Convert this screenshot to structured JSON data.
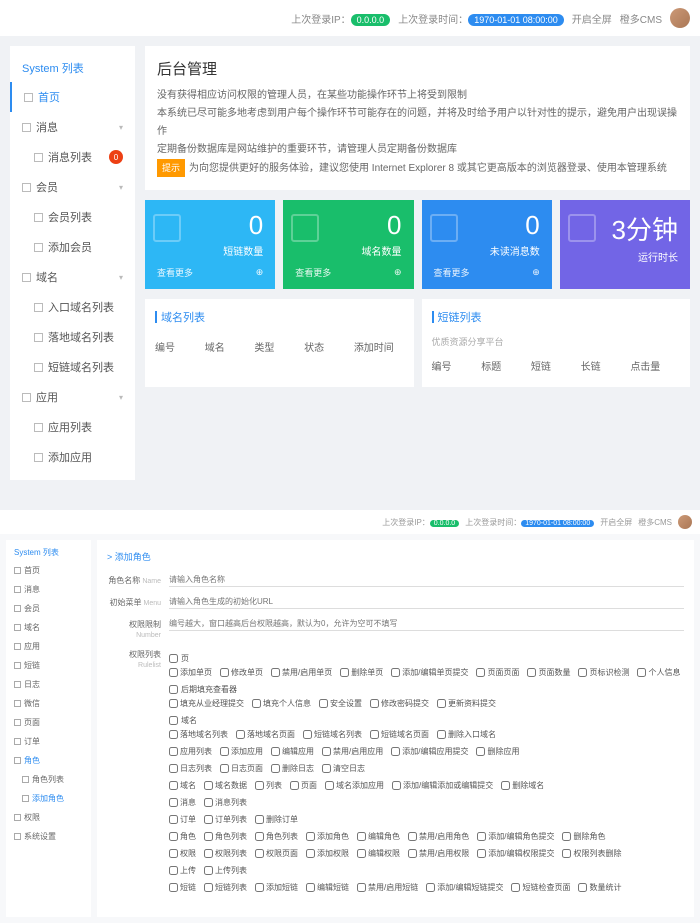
{
  "screen1": {
    "topbar": {
      "lastIpLabel": "上次登录IP：",
      "lastIp": "0.0.0.0",
      "lastTimeLabel": "上次登录时间：",
      "lastTime": "1970-01-01 08:00:00",
      "fullscreen": "开启全屏",
      "cms": "橙多CMS"
    },
    "sidebar": {
      "header": "System 列表",
      "items": [
        {
          "label": "首页",
          "active": true
        },
        {
          "label": "消息",
          "chev": true
        },
        {
          "label": "消息列表",
          "sub": true,
          "badge": "0"
        },
        {
          "label": "会员",
          "chev": true
        },
        {
          "label": "会员列表",
          "sub": true
        },
        {
          "label": "添加会员",
          "sub": true
        },
        {
          "label": "域名",
          "chev": true
        },
        {
          "label": "入口域名列表",
          "sub": true
        },
        {
          "label": "落地域名列表",
          "sub": true
        },
        {
          "label": "短链域名列表",
          "sub": true
        },
        {
          "label": "应用",
          "chev": true
        },
        {
          "label": "应用列表",
          "sub": true
        },
        {
          "label": "添加应用",
          "sub": true
        }
      ]
    },
    "panel": {
      "title": "后台管理",
      "lines": [
        "没有获得相应访问权限的管理人员，在某些功能操作环节上将受到限制",
        "本系统已尽可能多地考虑到用户每个操作环节可能存在的问题，并将及时给予用户以针对性的提示，避免用户出现误操作",
        "定期备份数据库是网站维护的重要环节，请管理人员定期备份数据库"
      ],
      "tipLabel": "提示",
      "tipText": "为向您提供更好的服务体验，建议您使用 Internet Explorer 8 或其它更高版本的浏览器登录、使用本管理系统"
    },
    "cards": [
      {
        "num": "0",
        "label": "短链数量",
        "more": "查看更多",
        "cls": "c1"
      },
      {
        "num": "0",
        "label": "域名数量",
        "more": "查看更多",
        "cls": "c2"
      },
      {
        "num": "0",
        "label": "未读消息数",
        "more": "查看更多",
        "cls": "c3"
      },
      {
        "num": "3分钟",
        "label": "运行时长",
        "more": "",
        "cls": "c4"
      }
    ],
    "tables": {
      "left": {
        "title": "域名列表",
        "cols": [
          "编号",
          "域名",
          "类型",
          "状态",
          "添加时间"
        ]
      },
      "right": {
        "title": "短链列表",
        "subtitle": "优质资源分享平台",
        "cols": [
          "编号",
          "标题",
          "短链",
          "长链",
          "点击量"
        ]
      }
    }
  },
  "screen2": {
    "topbar": {
      "lastIpLabel": "上次登录IP：",
      "lastIp": "0.0.0.0",
      "lastTimeLabel": "上次登录时间：",
      "lastTime": "1970-01-01 08:00:00",
      "fullscreen": "开启全屏",
      "cms": "橙多CMS"
    },
    "sidebar": {
      "header": "System 列表",
      "items": [
        {
          "label": "首页"
        },
        {
          "label": "消息"
        },
        {
          "label": "会员"
        },
        {
          "label": "域名"
        },
        {
          "label": "应用"
        },
        {
          "label": "短链"
        },
        {
          "label": "日志"
        },
        {
          "label": "微信"
        },
        {
          "label": "页面"
        },
        {
          "label": "订单"
        },
        {
          "label": "角色",
          "active": true
        },
        {
          "label": "角色列表",
          "sub": true
        },
        {
          "label": "添加角色",
          "sub": true,
          "active": true
        },
        {
          "label": "权限"
        },
        {
          "label": "系统设置"
        }
      ]
    },
    "crumbPrefix": "> ",
    "crumb": "添加角色",
    "form": {
      "name": {
        "label": "角色名称",
        "en": "Name",
        "placeholder": "请输入角色名称"
      },
      "menu": {
        "label": "初始菜单",
        "en": "Menu",
        "placeholder": "请输入角色生成的初始化URL"
      },
      "rule": {
        "label": "权限限制",
        "en": "Number",
        "placeholder": "编号越大，窗口越高后台权限越高，默认为0，允许为空可不填写"
      },
      "perm": {
        "label": "权限列表",
        "en": "Rulelist"
      }
    },
    "groups": [
      {
        "hdr": "页",
        "items": [
          "添加单页",
          "修改单页",
          "禁用/启用单页",
          "删除单页",
          "添加/编辑单页提交",
          "页面页面",
          "页面数量",
          "页标识检测",
          "个人信息"
        ]
      },
      {
        "hdr": "后期填充查看器",
        "items": [
          "填充从业经理提交",
          "填充个人信息",
          "安全设置",
          "修改密码提交",
          "更新资料提交"
        ]
      },
      {
        "hdr": "域名",
        "items": [
          "落地域名列表",
          "落地域名页面",
          "短链域名列表",
          "短链域名页面",
          "删除入口域名"
        ]
      },
      {
        "hdr": "",
        "items": [
          "应用列表",
          "添加应用",
          "编辑应用",
          "禁用/启用应用",
          "添加/编辑应用提交",
          "删除应用"
        ]
      },
      {
        "hdr": "",
        "items": [
          "日志列表",
          "日志页面",
          "删除日志",
          "清空日志"
        ]
      },
      {
        "hdr": "",
        "items": [
          "域名",
          "域名数据",
          "列表",
          "页面",
          "域名添加应用",
          "添加/编辑添加或编辑提交",
          "删除域名"
        ]
      },
      {
        "hdr": "",
        "items": [
          "消息",
          "消息列表"
        ]
      },
      {
        "hdr": "",
        "items": [
          "订单",
          "订单列表",
          "删除订单"
        ]
      },
      {
        "hdr": "",
        "items": [
          "角色",
          "角色列表",
          "角色列表",
          "添加角色",
          "编辑角色",
          "禁用/启用角色",
          "添加/编辑角色提交",
          "删除角色"
        ]
      },
      {
        "hdr": "",
        "items": [
          "权限",
          "权限列表",
          "权限页面",
          "添加权限",
          "编辑权限",
          "禁用/启用权限",
          "添加/编辑权限提交",
          "权限列表删除"
        ]
      },
      {
        "hdr": "",
        "items": [
          "上传",
          "上传列表"
        ]
      },
      {
        "hdr": "",
        "items": [
          "短链",
          "短链列表",
          "添加短链",
          "编辑短链",
          "禁用/启用短链",
          "添加/编辑短链提交",
          "短链检查页面",
          "数量统计"
        ]
      }
    ]
  }
}
